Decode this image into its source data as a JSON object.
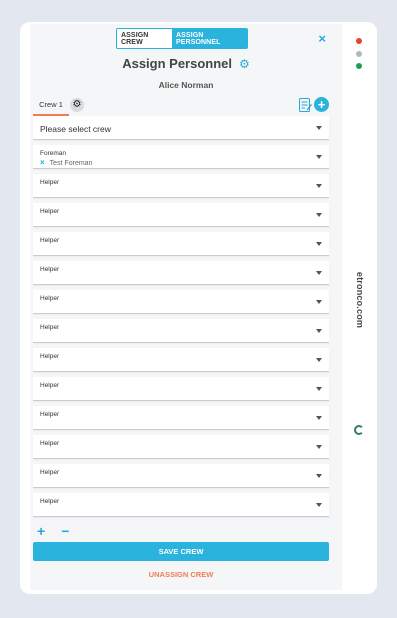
{
  "header": {
    "toggle": {
      "assign_crew": "ASSIGN CREW",
      "assign_personnel": "ASSIGN PERSONNEL"
    },
    "close_symbol": "×",
    "title": "Assign Personnel",
    "subtitle": "Alice Norman"
  },
  "tabs": {
    "items": [
      {
        "label": "Crew 1"
      }
    ]
  },
  "crew_select": {
    "placeholder": "Please select crew"
  },
  "foreman": {
    "label": "Foreman",
    "value": "Test Foreman",
    "remove_symbol": "×"
  },
  "helpers": [
    {
      "label": "Helper"
    },
    {
      "label": "Helper"
    },
    {
      "label": "Helper"
    },
    {
      "label": "Helper"
    },
    {
      "label": "Helper"
    },
    {
      "label": "Helper"
    },
    {
      "label": "Helper"
    },
    {
      "label": "Helper"
    },
    {
      "label": "Helper"
    },
    {
      "label": "Helper"
    },
    {
      "label": "Helper"
    },
    {
      "label": "Helper"
    }
  ],
  "controls": {
    "add_symbol": "+",
    "remove_symbol": "−"
  },
  "actions": {
    "save": "SAVE CREW",
    "unassign": "UNASSIGN CREW"
  },
  "sidebar": {
    "dots": [
      {
        "color": "#e8442a"
      },
      {
        "color": "#b5b8bb"
      },
      {
        "color": "#1f9e57"
      }
    ],
    "brand": "etronco.com"
  },
  "colors": {
    "accent": "#29b3dd",
    "warning": "#f07e55"
  },
  "icons": [
    "close-icon",
    "gear-icon",
    "notes-icon",
    "add-icon",
    "chevron-down-icon",
    "remove-icon",
    "refresh-icon"
  ]
}
